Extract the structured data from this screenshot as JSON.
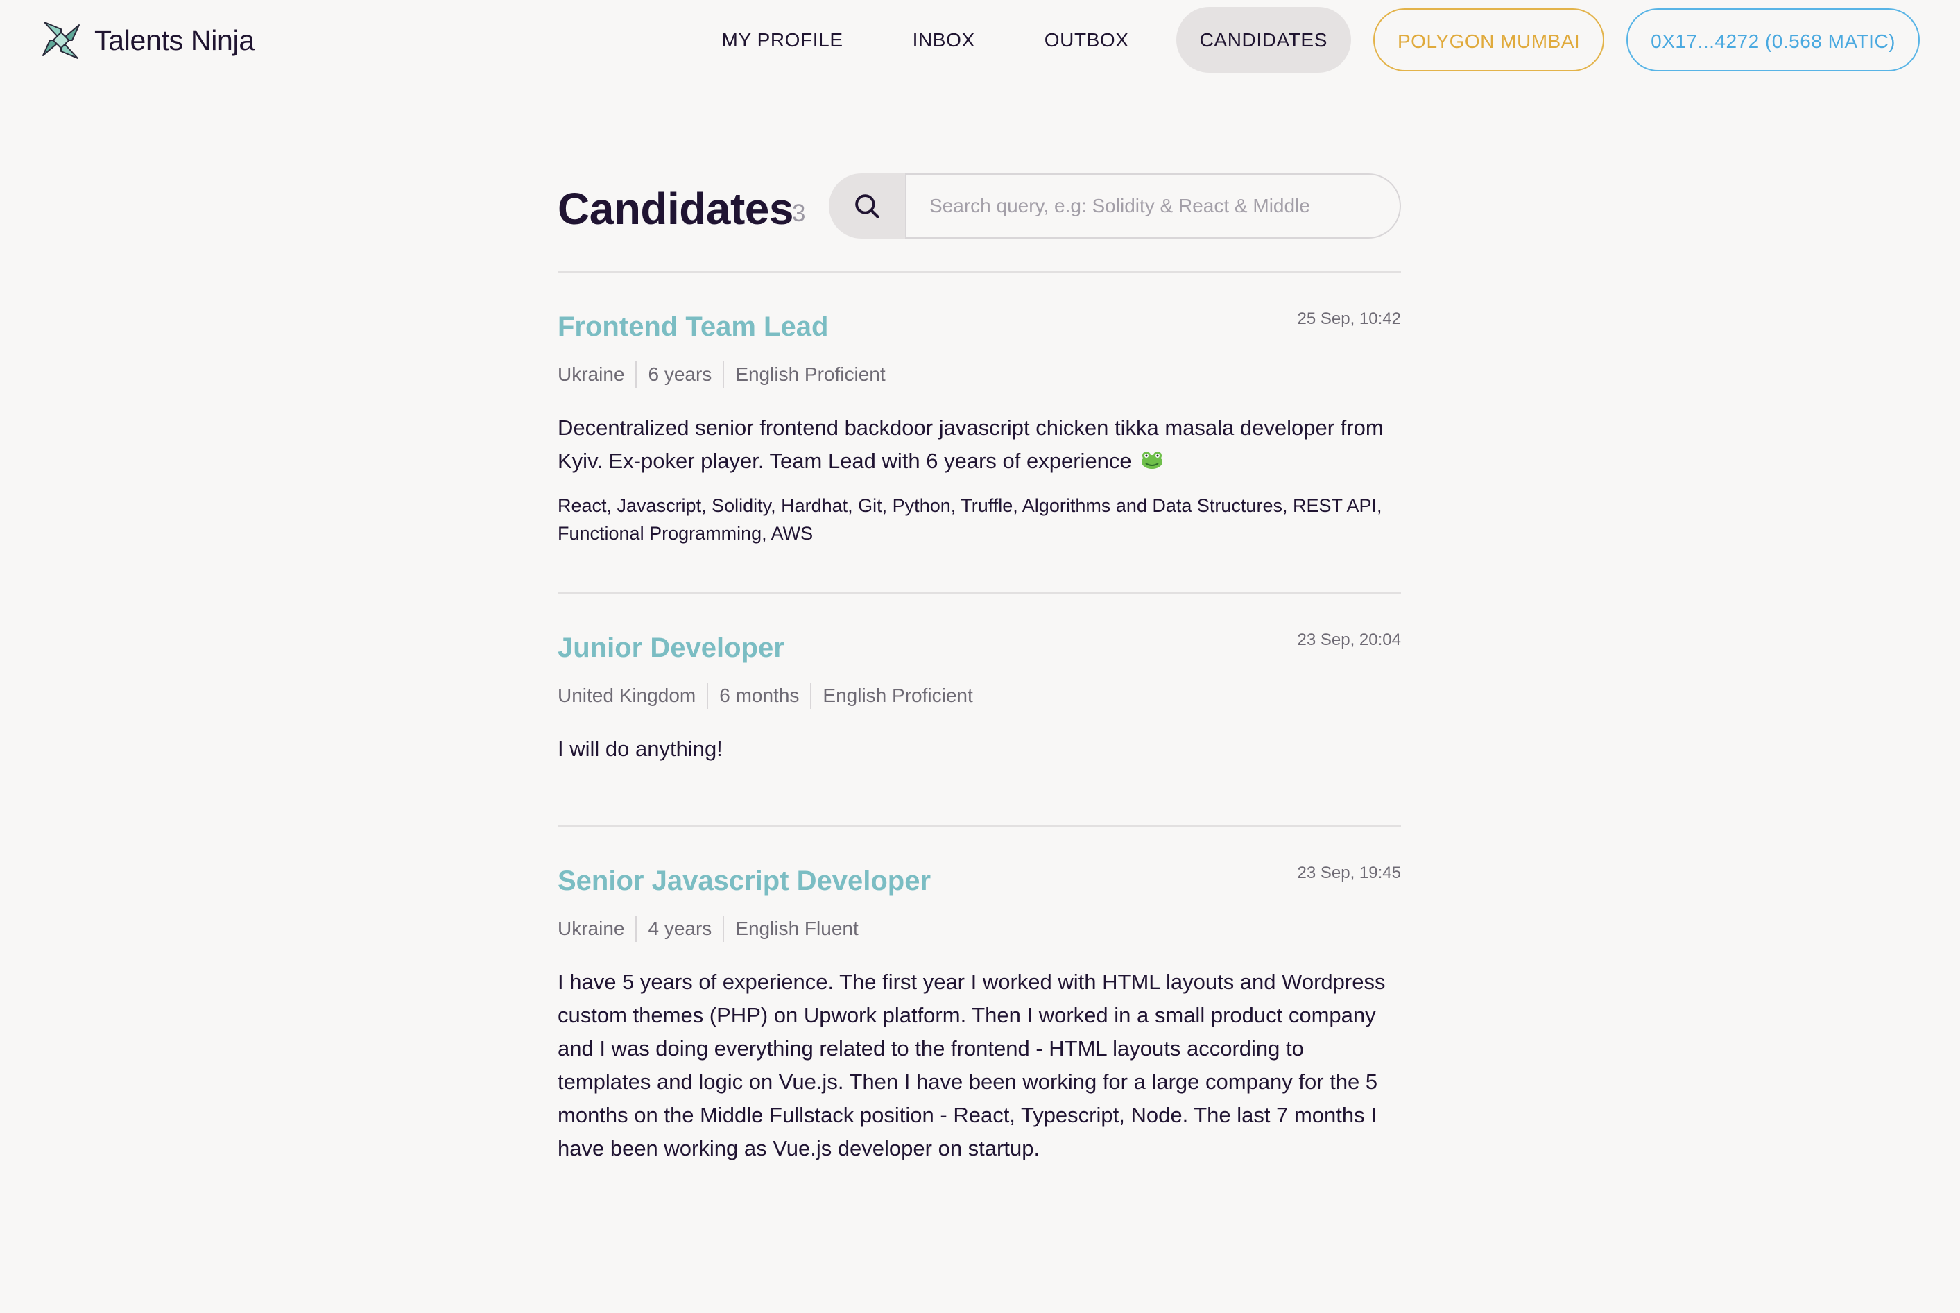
{
  "app": {
    "name": "Talents Ninja"
  },
  "nav": {
    "items": [
      {
        "label": "MY PROFILE"
      },
      {
        "label": "INBOX"
      },
      {
        "label": "OUTBOX"
      },
      {
        "label": "CANDIDATES",
        "active": true
      }
    ],
    "network_label": "POLYGON MUMBAI",
    "wallet_label": "0X17...4272 (0.568 MATIC)"
  },
  "page": {
    "title": "Candidates",
    "count": "3"
  },
  "search": {
    "placeholder": "Search query, e.g: Solidity & React & Middle",
    "value": ""
  },
  "candidates": [
    {
      "title": "Frontend Team Lead",
      "date": "25 Sep, 10:42",
      "country": "Ukraine",
      "experience": "6 years",
      "english": "English Proficient",
      "description": "Decentralized senior frontend backdoor javascript chicken tikka masala developer from Kyiv. Ex-poker player. Team Lead with 6 years of experience",
      "emoji": "frog-icon",
      "skills": "React, Javascript, Solidity, Hardhat, Git, Python, Truffle, Algorithms and Data Structures, REST API, Functional Programming, AWS"
    },
    {
      "title": "Junior Developer",
      "date": "23 Sep, 20:04",
      "country": "United Kingdom",
      "experience": "6 months",
      "english": "English Proficient",
      "description": "I will do anything!"
    },
    {
      "title": "Senior Javascript Developer",
      "date": "23 Sep, 19:45",
      "country": "Ukraine",
      "experience": "4 years",
      "english": "English Fluent",
      "description": "I have 5 years of experience. The first year I worked with HTML layouts and Wordpress custom themes (PHP) on Upwork platform. Then I worked in a small product company and I was doing everything related to the frontend - HTML layouts according to templates and logic on Vue.js. Then I have been working for a large company for the 5 months on the Middle Fullstack position - React, Typescript, Node. The last 7 months I have been working as Vue.js developer on startup."
    }
  ],
  "colors": {
    "background": "#f8f7f6",
    "accent_title": "#7bbdc3",
    "network": "#e0aa3c",
    "wallet": "#4aa9e0",
    "text": "#201432"
  }
}
